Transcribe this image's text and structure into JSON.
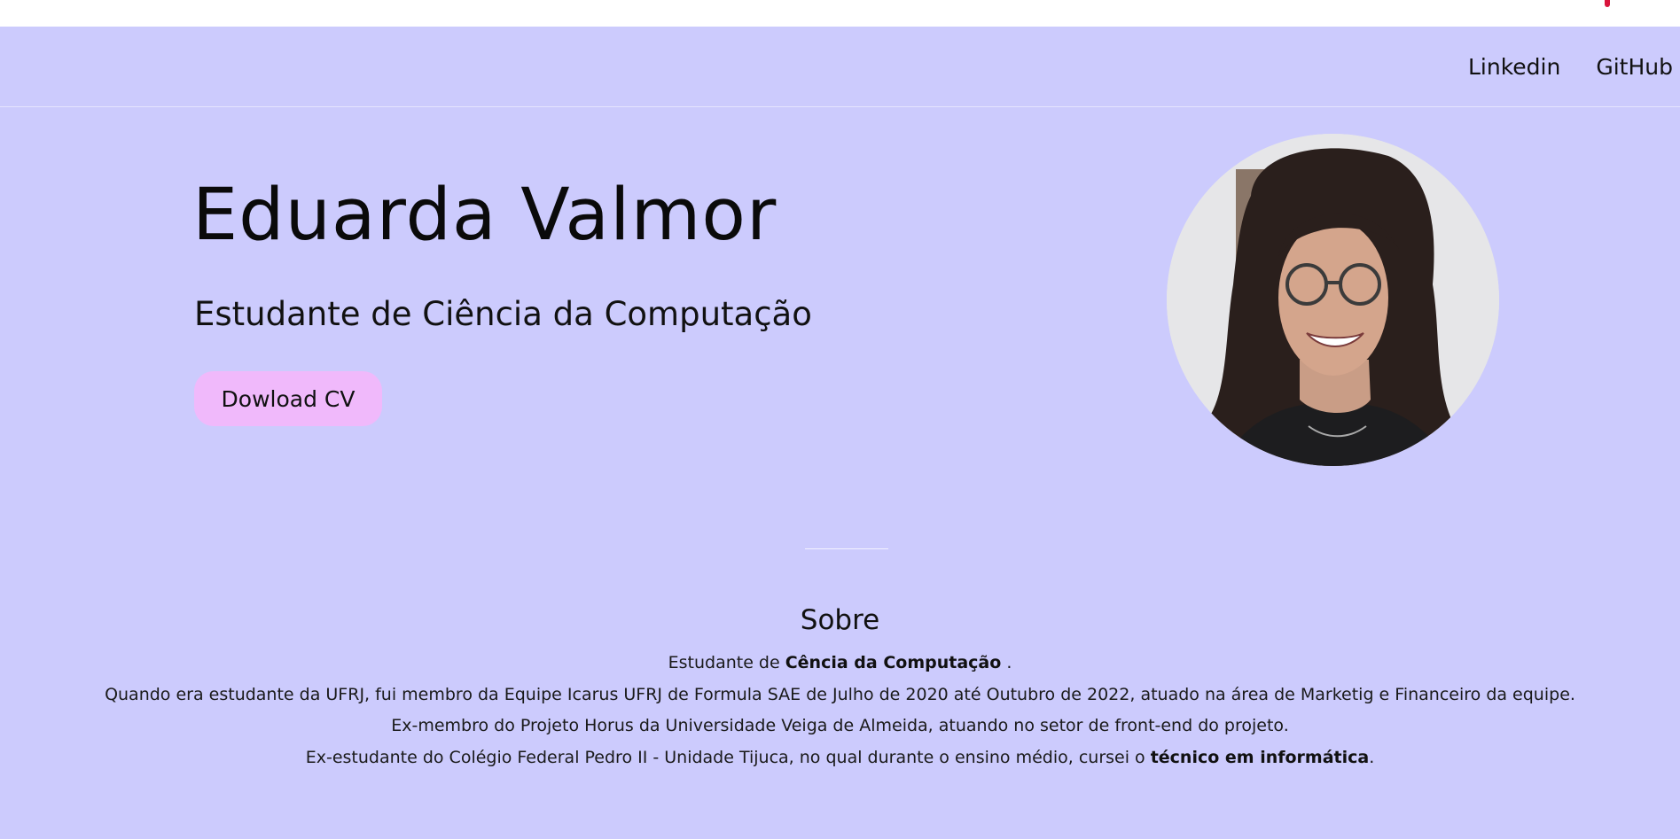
{
  "colors": {
    "background": "#cccbfd",
    "button": "#f0b9fb",
    "top_strip": "#ffffff",
    "top_mark": "#d9143c"
  },
  "nav": {
    "links": [
      "Linkedin",
      "GitHub"
    ]
  },
  "hero": {
    "name": "Eduarda Valmor",
    "subtitle": "Estudante de Ciência da Computação",
    "cv_button": "Dowload CV",
    "photo_icon": "profile-photo"
  },
  "about": {
    "title": "Sobre",
    "line1": {
      "before": "Estudante de ",
      "bold": "Cência da Computação",
      "after": " ."
    },
    "line2": "Quando era estudante da UFRJ, fui membro da Equipe Icarus UFRJ de Formula SAE de Julho de 2020 até Outubro de 2022, atuado na área de Marketig e Financeiro da equipe.",
    "line3": "Ex-membro do Projeto Horus da Universidade Veiga de Almeida, atuando no setor de front-end do projeto.",
    "line4": {
      "before": "Ex-estudante do Colégio Federal Pedro II - Unidade Tijuca, no qual durante o ensino médio, cursei o ",
      "bold": "técnico em informática",
      "after": "."
    }
  }
}
